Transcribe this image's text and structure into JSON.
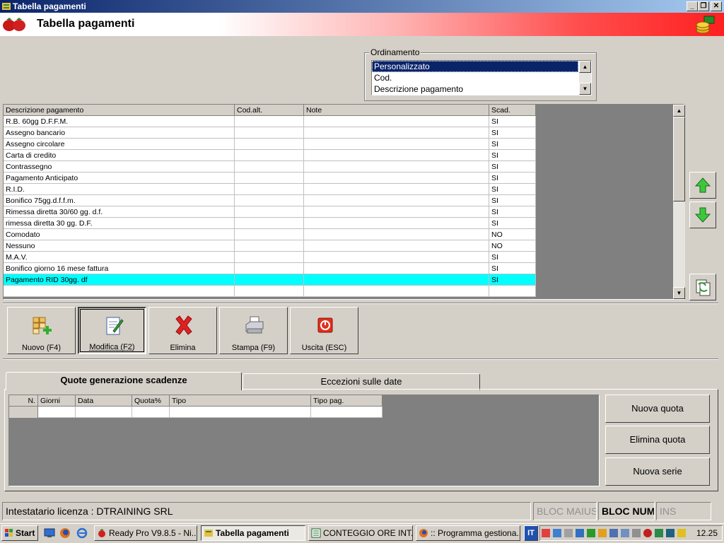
{
  "window": {
    "title": "Tabella pagamenti"
  },
  "header": {
    "title": "Tabella pagamenti"
  },
  "ordinamento": {
    "label": "Ordinamento",
    "options": [
      "Personalizzato",
      "Cod.",
      "Descrizione pagamento"
    ],
    "selected": "Personalizzato"
  },
  "grid": {
    "columns": [
      "Descrizione pagamento",
      "Cod.alt.",
      "Note",
      "Scad."
    ],
    "rows": [
      {
        "desc": "R.B. 60gg D.F.F.M.",
        "cod": "",
        "note": "",
        "scad": "SI"
      },
      {
        "desc": "Assegno bancario",
        "cod": "",
        "note": "",
        "scad": "SI"
      },
      {
        "desc": "Assegno circolare",
        "cod": "",
        "note": "",
        "scad": "SI"
      },
      {
        "desc": "Carta di credito",
        "cod": "",
        "note": "",
        "scad": "SI"
      },
      {
        "desc": "Contrassegno",
        "cod": "",
        "note": "",
        "scad": "SI"
      },
      {
        "desc": "Pagamento Anticipato",
        "cod": "",
        "note": "",
        "scad": "SI"
      },
      {
        "desc": "R.I.D.",
        "cod": "",
        "note": "",
        "scad": "SI"
      },
      {
        "desc": "Bonifico 75gg.d.f.f.m.",
        "cod": "",
        "note": "",
        "scad": "SI"
      },
      {
        "desc": "Rimessa diretta 30/60 gg. d.f.",
        "cod": "",
        "note": "",
        "scad": "SI"
      },
      {
        "desc": "rimessa diretta 30 gg. D.F.",
        "cod": "",
        "note": "",
        "scad": "SI"
      },
      {
        "desc": "Comodato",
        "cod": "",
        "note": "",
        "scad": "NO"
      },
      {
        "desc": "Nessuno",
        "cod": "",
        "note": "",
        "scad": "NO"
      },
      {
        "desc": "M.A.V.",
        "cod": "",
        "note": "",
        "scad": "SI"
      },
      {
        "desc": "Bonifico giorno 16 mese fattura",
        "cod": "",
        "note": "",
        "scad": "SI"
      },
      {
        "desc": "Pagamento RID 30gg. df",
        "cod": "",
        "note": "",
        "scad": "SI"
      }
    ],
    "selected_row": 14
  },
  "toolbar": {
    "nuovo": "Nuovo (F4)",
    "modifica": "Modifica (F2)",
    "elimina": "Elimina",
    "stampa": "Stampa (F9)",
    "uscita": "Uscita (ESC)"
  },
  "tabs": {
    "quote": "Quote generazione scadenze",
    "eccezioni": "Eccezioni sulle date"
  },
  "quote_grid": {
    "columns": [
      "N.",
      "Giorni",
      "Data",
      "Quota%",
      "Tipo",
      "Tipo pag."
    ]
  },
  "quote_buttons": {
    "nuova_quota": "Nuova quota",
    "elimina_quota": "Elimina quota",
    "nuova_serie": "Nuova serie"
  },
  "status": {
    "license": "Intestatario licenza : DTRAINING SRL",
    "caps": "BLOC MAIUSC",
    "num": "BLOC NUM",
    "ins": "INS"
  },
  "taskbar": {
    "start": "Start",
    "items": [
      "Ready Pro V9.8.5 - Ni...",
      "Tabella pagamenti",
      "CONTEGGIO ORE INT...",
      ":: Programma gestiona..."
    ],
    "clock": "12.25"
  },
  "colors": {
    "selection": "#00ffff",
    "titlebar": "#0a246a",
    "header_red": "#ff2020"
  }
}
